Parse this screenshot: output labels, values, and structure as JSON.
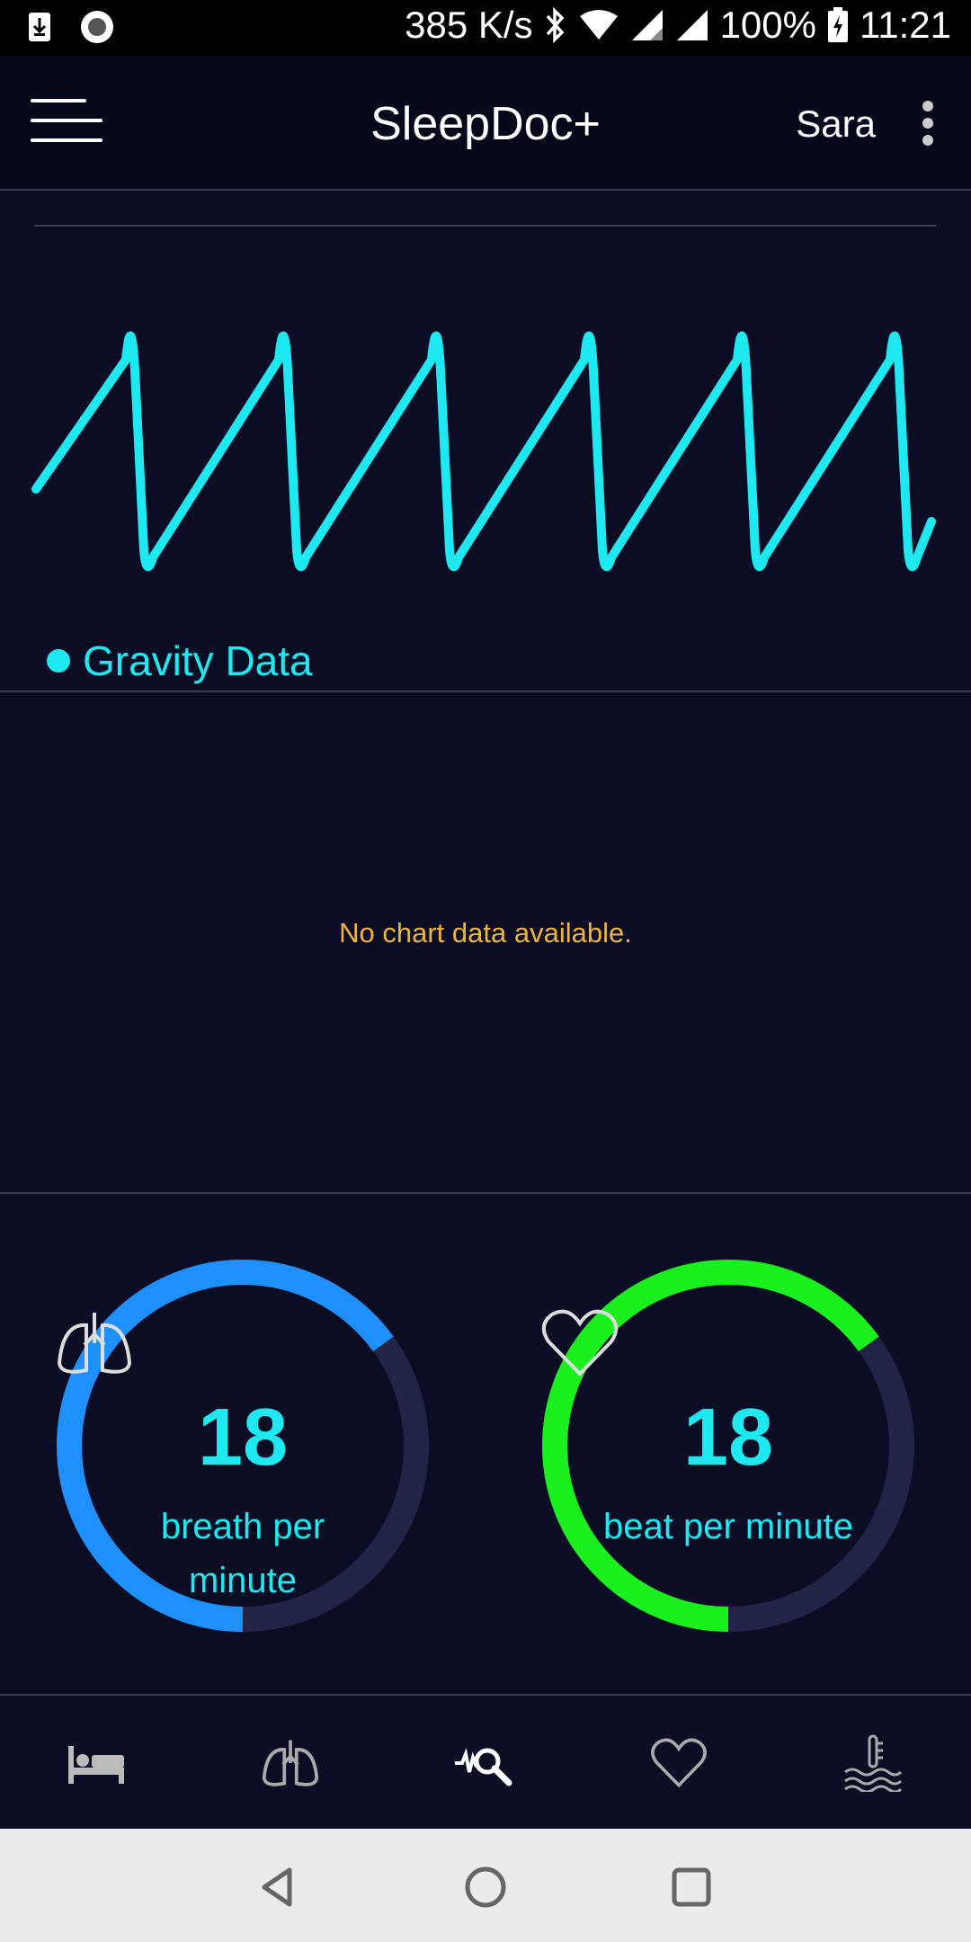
{
  "status_bar": {
    "net_speed": "385 K/s",
    "battery": "100%",
    "time": "11:21",
    "icons": [
      "download-icon",
      "record-icon",
      "bluetooth-icon",
      "wifi-icon",
      "signal-icon",
      "signal-icon",
      "battery-charging-icon"
    ]
  },
  "app_bar": {
    "title": "SleepDoc+",
    "user": "Sara",
    "menu_icon": "hamburger-menu-icon",
    "more_icon": "more-vert-icon"
  },
  "gravity_chart": {
    "legend": "Gravity Data",
    "color": "#1ee8f0"
  },
  "second_chart": {
    "empty_message": "No chart data available.",
    "message_color": "#f0b43c"
  },
  "gauges": {
    "breath": {
      "value": "18",
      "unit": "breath per minute",
      "progress": 0.65,
      "color": "#1e90ff",
      "icon": "lungs-icon"
    },
    "heart": {
      "value": "18",
      "unit": "beat per minute",
      "progress": 0.65,
      "color": "#19f01e",
      "icon": "heart-icon"
    }
  },
  "bottom_nav": {
    "items": [
      {
        "icon": "bed-icon",
        "active": false
      },
      {
        "icon": "lungs-icon",
        "active": false
      },
      {
        "icon": "wave-search-icon",
        "active": true
      },
      {
        "icon": "heart-icon",
        "active": false
      },
      {
        "icon": "temperature-water-icon",
        "active": false
      }
    ]
  },
  "system_nav": {
    "icons": [
      "back-icon",
      "home-icon",
      "recents-icon"
    ]
  }
}
